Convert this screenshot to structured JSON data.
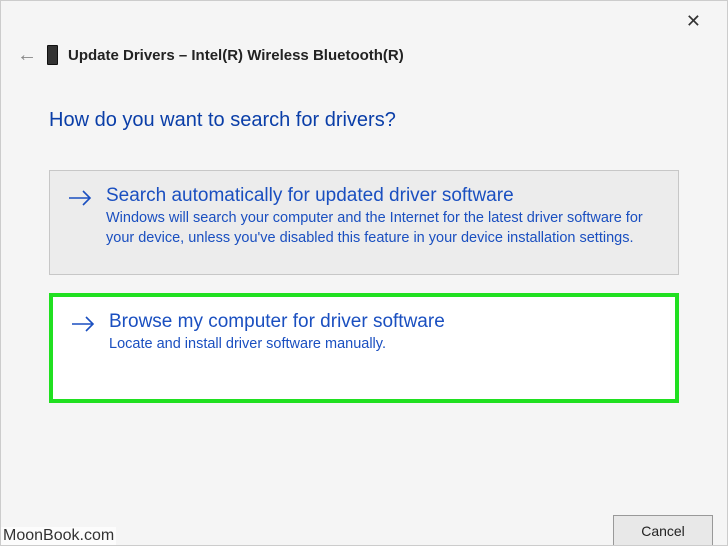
{
  "close_glyph": "✕",
  "back_glyph": "←",
  "header": {
    "title": "Update Drivers – Intel(R) Wireless Bluetooth(R)"
  },
  "question": "How do you want to search for drivers?",
  "options": [
    {
      "title": "Search automatically for updated driver software",
      "desc": "Windows will search your computer and the Internet for the latest driver software for your device, unless you've disabled this feature in your device installation settings."
    },
    {
      "title": "Browse my computer for driver software",
      "desc": "Locate and install driver software manually."
    }
  ],
  "cancel_label": "Cancel",
  "watermark": "MoonBook.com"
}
